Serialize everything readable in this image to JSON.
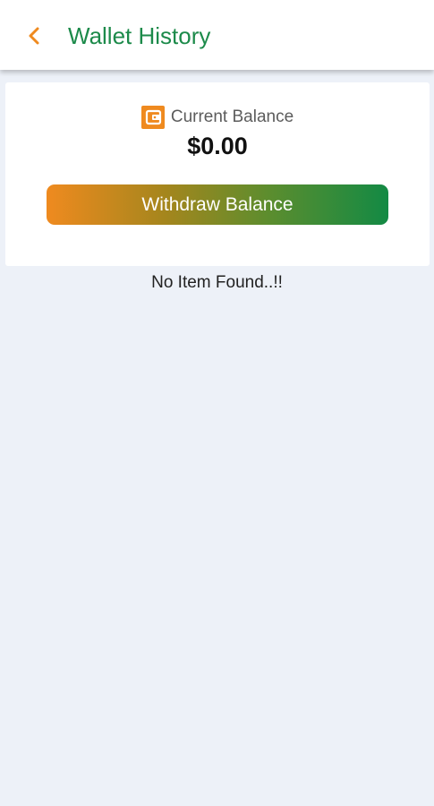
{
  "header": {
    "title": "Wallet History",
    "back_icon": "chevron-left-icon"
  },
  "balance_card": {
    "label": "Current Balance",
    "wallet_icon": "wallet-icon",
    "amount": "$0.00",
    "withdraw_label": "Withdraw Balance"
  },
  "history": {
    "empty_message": "No Item Found..!!"
  },
  "colors": {
    "accent_orange": "#ef8a1f",
    "accent_green": "#1c8a4a",
    "background": "#edf1f8"
  }
}
